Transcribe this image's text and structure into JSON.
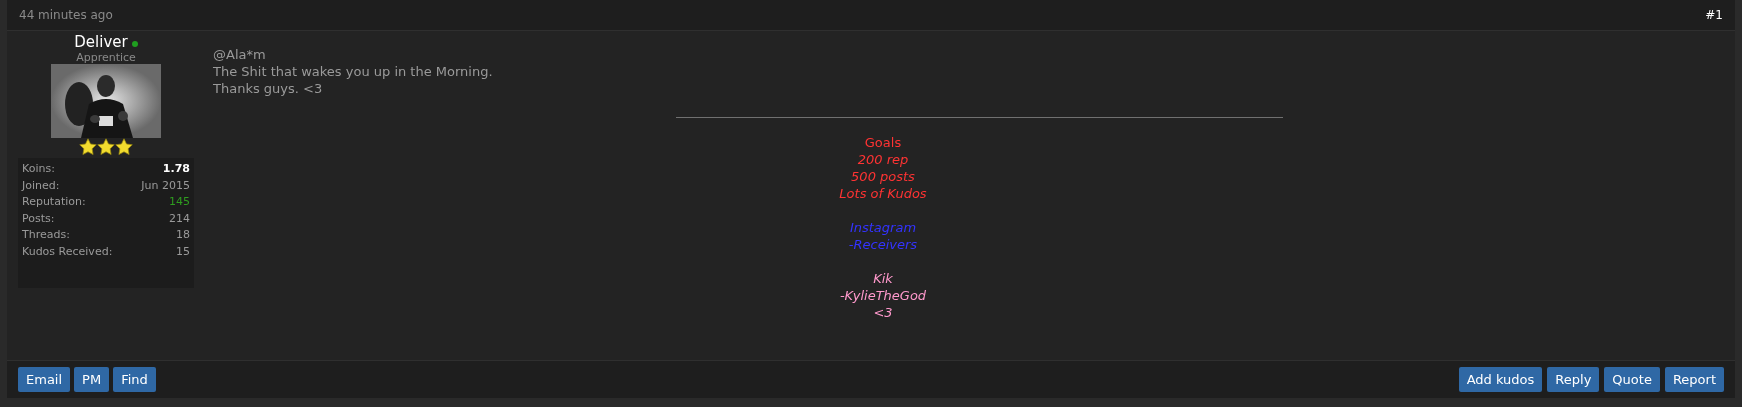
{
  "post": {
    "time": "44 minutes ago",
    "number": "#1"
  },
  "author": {
    "name": "Deliver",
    "online": true,
    "rank": "Apprentice",
    "stars": 3,
    "stats": [
      {
        "label": "Koins:",
        "value": "1.78",
        "color": "#ffffff"
      },
      {
        "label": "Joined:",
        "value": "Jun 2015",
        "color": "#9a9a9a"
      },
      {
        "label": "Reputation:",
        "value": "145",
        "color": "#2e9c1f"
      },
      {
        "label": "Posts:",
        "value": "214",
        "color": "#9a9a9a"
      },
      {
        "label": "Threads:",
        "value": "18",
        "color": "#9a9a9a"
      },
      {
        "label": "Kudos Received:",
        "value": "15",
        "color": "#9a9a9a"
      }
    ]
  },
  "message": [
    "@Ala*m",
    "The Shit that wakes you up in the Morning.",
    "Thanks guys. <3"
  ],
  "signature": [
    {
      "color": "#ff3333",
      "lines": [
        {
          "text": "Goals",
          "italic": false
        },
        {
          "text": "200 rep",
          "italic": true
        },
        {
          "text": "500 posts",
          "italic": true
        },
        {
          "text": "Lots of Kudos",
          "italic": true
        }
      ]
    },
    {
      "color": "#3333ff",
      "lines": [
        {
          "text": "Instagram",
          "italic": true
        },
        {
          "text": "-Receivers",
          "italic": true
        }
      ]
    },
    {
      "color": "#ff99cc",
      "lines": [
        {
          "text": "Kik",
          "italic": true
        },
        {
          "text": "-KylieTheGod",
          "italic": true
        },
        {
          "text": "<3",
          "italic": true
        }
      ]
    }
  ],
  "left_buttons": [
    "Email",
    "PM",
    "Find"
  ],
  "right_buttons": [
    "Add kudos",
    "Reply",
    "Quote",
    "Report"
  ]
}
